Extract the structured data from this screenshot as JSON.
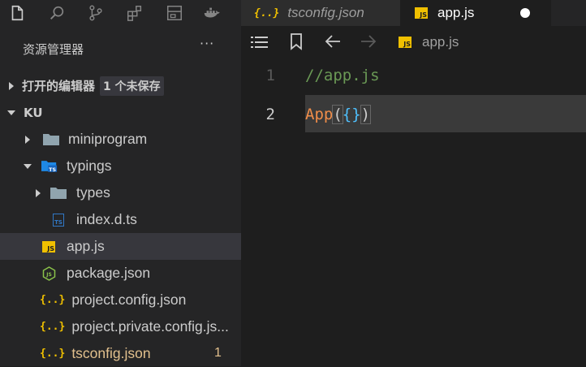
{
  "explorer": {
    "title": "资源管理器",
    "more": "···",
    "open_editors": {
      "label": "打开的编辑器",
      "badge": "1 个未保存"
    },
    "workspace": {
      "label": "KU"
    },
    "tree": [
      {
        "name": "miniprogram",
        "type": "folder",
        "expanded": false
      },
      {
        "name": "typings",
        "type": "folder-ts",
        "expanded": true
      },
      {
        "name": "types",
        "type": "folder",
        "expanded": false
      },
      {
        "name": "index.d.ts",
        "type": "ts"
      },
      {
        "name": "app.js",
        "type": "js",
        "selected": true
      },
      {
        "name": "package.json",
        "type": "npm"
      },
      {
        "name": "project.config.json",
        "type": "json"
      },
      {
        "name": "project.private.config.js...",
        "type": "json"
      },
      {
        "name": "tsconfig.json",
        "type": "json",
        "problems": "1",
        "color": "#e2c08d"
      }
    ]
  },
  "activity_icons": [
    "files-icon",
    "search-icon",
    "source-control-icon",
    "extensions-icon",
    "panel-icon",
    "docker-icon"
  ],
  "tabs": [
    {
      "label": "tsconfig.json",
      "icon": "{..}",
      "active": false
    },
    {
      "label": "app.js",
      "icon": "JS",
      "active": true,
      "dirty": true
    }
  ],
  "breadcrumb": {
    "file": "app.js"
  },
  "editor": {
    "lines": [
      {
        "number": "1",
        "text": "//app.js"
      },
      {
        "number": "2",
        "text": "App({})"
      }
    ],
    "code_line2": {
      "fn": "App",
      "open_paren": "(",
      "braces": "{}",
      "close_paren": ")"
    }
  },
  "colors": {
    "comment": "#6a9955",
    "function": "#f08d49",
    "brace": "#4fc1ff",
    "modified": "#e2c08d"
  }
}
